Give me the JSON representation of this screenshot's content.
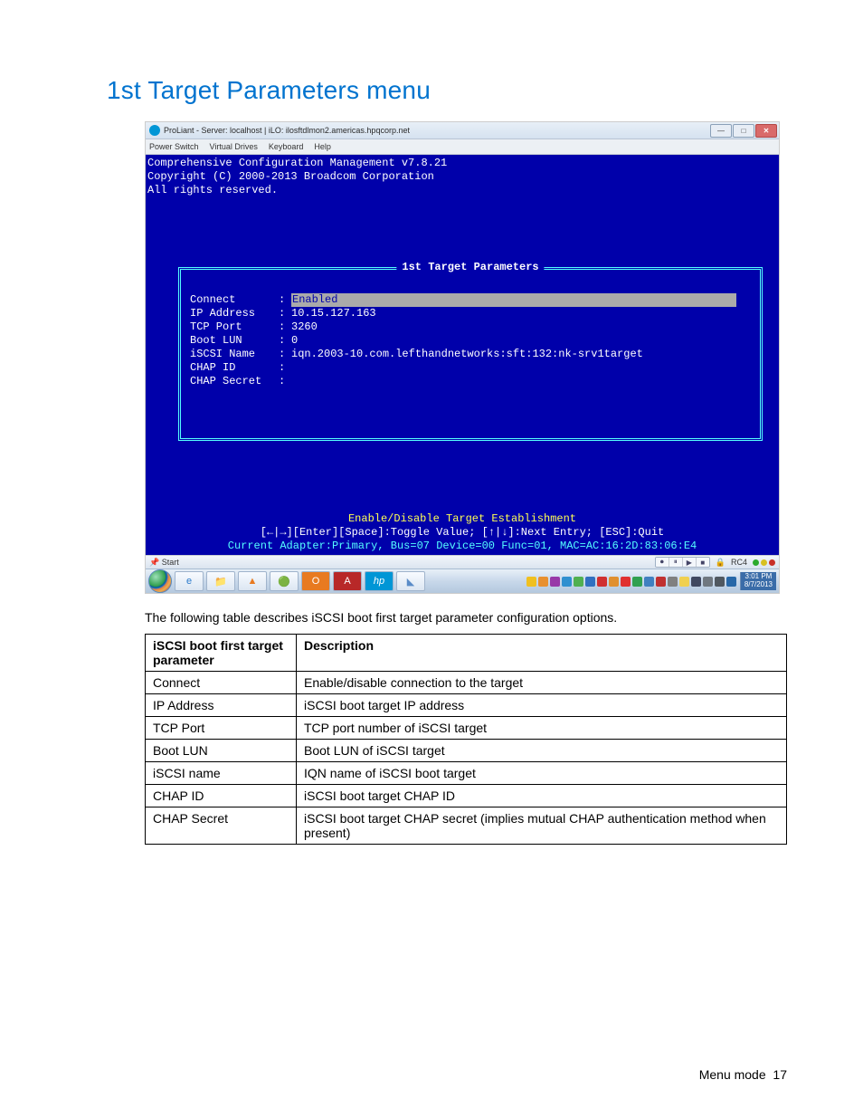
{
  "heading": "1st Target Parameters menu",
  "window": {
    "title": "ProLiant - Server: localhost | iLO: ilosftdlmon2.americas.hpqcorp.net",
    "menu": [
      "Power Switch",
      "Virtual Drives",
      "Keyboard",
      "Help"
    ]
  },
  "console": {
    "header1": "Comprehensive Configuration Management v7.8.21",
    "header2": "Copyright (C) 2000-2013 Broadcom Corporation",
    "header3": "All rights reserved.",
    "frame_title": "1st Target Parameters",
    "fields": [
      {
        "label": "Connect",
        "value": "Enabled",
        "selected": true
      },
      {
        "label": "IP Address",
        "value": "10.15.127.163",
        "selected": false
      },
      {
        "label": "TCP Port",
        "value": "3260",
        "selected": false
      },
      {
        "label": "Boot LUN",
        "value": "0",
        "selected": false
      },
      {
        "label": "iSCSI Name",
        "value": "iqn.2003-10.com.lefthandnetworks:sft:132:nk-srv1target",
        "selected": false
      },
      {
        "label": "CHAP ID",
        "value": "",
        "selected": false
      },
      {
        "label": "CHAP Secret",
        "value": "",
        "selected": false
      }
    ],
    "hint1": "Enable/Disable Target Establishment",
    "hint2": "[←|→][Enter][Space]:Toggle Value; [↑|↓]:Next Entry; [ESC]:Quit",
    "hint3": "Current Adapter:Primary, Bus=07 Device=00 Func=01, MAC=AC:16:2D:83:06:E4"
  },
  "statusbar": {
    "start": "Start",
    "enc": "RC4"
  },
  "clock": {
    "time": "3:01 PM",
    "date": "8/7/2013"
  },
  "caption": "The following table describes iSCSI boot first target parameter configuration options.",
  "table": {
    "head": [
      "iSCSI boot first target parameter",
      "Description"
    ],
    "rows": [
      [
        "Connect",
        "Enable/disable connection to the target"
      ],
      [
        "IP Address",
        "iSCSI boot target IP address"
      ],
      [
        "TCP Port",
        "TCP port number of iSCSI target"
      ],
      [
        "Boot LUN",
        "Boot LUN of iSCSI target"
      ],
      [
        "iSCSI name",
        "IQN name of iSCSI boot target"
      ],
      [
        "CHAP ID",
        "iSCSI boot target CHAP ID"
      ],
      [
        "CHAP Secret",
        "iSCSI boot target CHAP secret (implies mutual CHAP authentication method when present)"
      ]
    ]
  },
  "footer": {
    "section": "Menu mode",
    "page": "17"
  }
}
